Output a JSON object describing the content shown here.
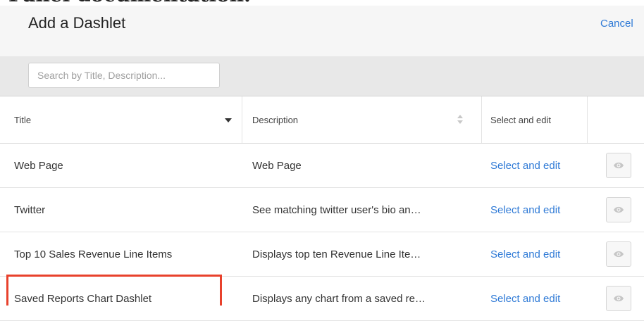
{
  "stray_heading": "Panel documentation.",
  "dialog": {
    "title": "Add a Dashlet",
    "cancel_label": "Cancel"
  },
  "search": {
    "placeholder": "Search by Title, Description..."
  },
  "table": {
    "columns": {
      "title": "Title",
      "description": "Description",
      "select": "Select and edit"
    },
    "rows": [
      {
        "title": "Web Page",
        "description": "Web Page",
        "action": "Select and edit",
        "preview_icon": "eye-icon"
      },
      {
        "title": "Twitter",
        "description": "See matching twitter user's bio an…",
        "action": "Select and edit",
        "preview_icon": "eye-icon"
      },
      {
        "title": "Top 10 Sales Revenue Line Items",
        "description": "Displays top ten Revenue Line Ite…",
        "action": "Select and edit",
        "preview_icon": "eye-icon"
      },
      {
        "title": "Saved Reports Chart Dashlet",
        "description": "Displays any chart from a saved re…",
        "action": "Select and edit",
        "preview_icon": "eye-icon"
      }
    ]
  },
  "colors": {
    "link": "#2f7ad6",
    "highlight": "#e8412c",
    "header_bg": "#f6f6f6",
    "search_bar_bg": "#e8e8e8"
  }
}
